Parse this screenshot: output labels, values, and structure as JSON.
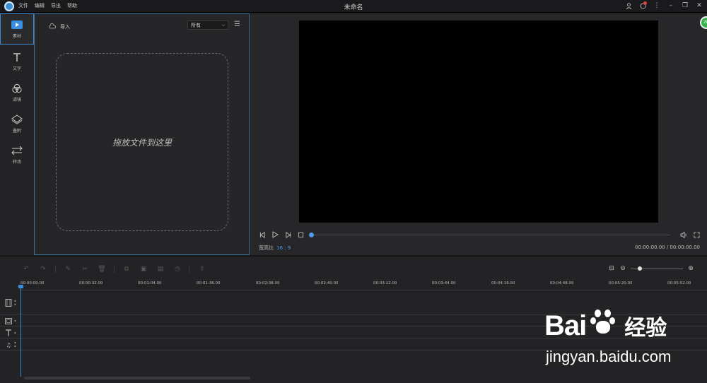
{
  "titlebar": {
    "menu": [
      "文件",
      "编辑",
      "导出",
      "帮助"
    ],
    "title": "未命名"
  },
  "rail": {
    "items": [
      {
        "label": "素材",
        "icon": "media-play-icon"
      },
      {
        "label": "文字",
        "icon": "text-t-icon"
      },
      {
        "label": "滤镜",
        "icon": "filter-circles-icon"
      },
      {
        "label": "叠附",
        "icon": "overlay-layers-icon"
      },
      {
        "label": "转场",
        "icon": "transition-arrows-icon"
      }
    ]
  },
  "media": {
    "import_label": "导入",
    "filter_value": "所有",
    "drop_text": "拖放文件到这里"
  },
  "preview": {
    "avatar_text": "ZH",
    "aspect_label": "宽高比",
    "aspect_value": "16 : 9",
    "timecode": "00:00:00.00 / 00:00:00.00",
    "progress": 0
  },
  "timeline": {
    "ticks": [
      "00:00:00.00",
      "00:00:32.00",
      "00:01:04.00",
      "00:01:36.00",
      "00:02:08.00",
      "00:02:40.00",
      "00:03:12.00",
      "00:03:44.00",
      "00:04:16.00",
      "00:04:48.00",
      "00:05:20.00",
      "00:05:52.00"
    ]
  },
  "watermark": {
    "brand": "Bai",
    "brand_suffix": "经验",
    "url": "jingyan.baidu.com"
  }
}
